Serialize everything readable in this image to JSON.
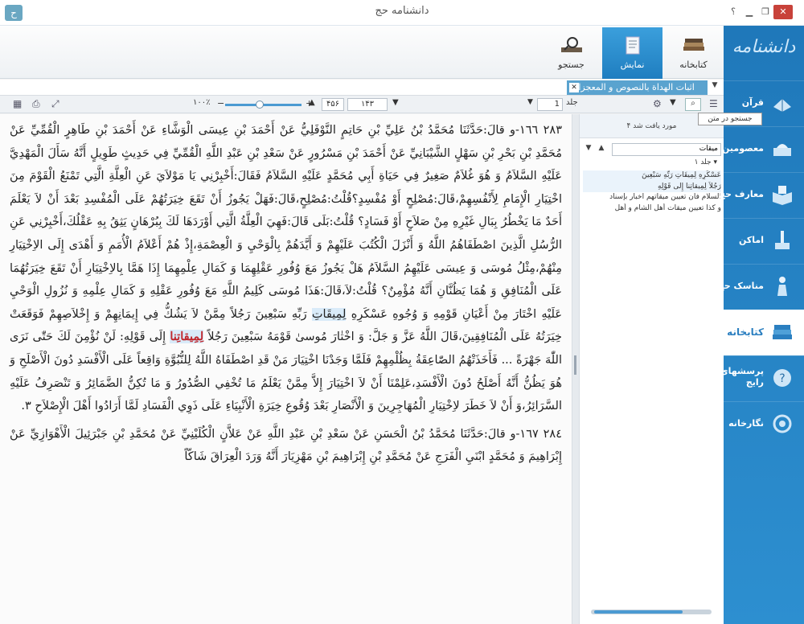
{
  "window": {
    "title": "دانشنامه حج",
    "logo_glyph": "ح",
    "help": "؟"
  },
  "nav": {
    "logo": "دانشنامه",
    "items": [
      {
        "label": "قرآن",
        "icon": "quran-icon"
      },
      {
        "label": "معصومین",
        "icon": "shrine-icon"
      },
      {
        "label": "معارف حج",
        "icon": "book-open-icon"
      },
      {
        "label": "اماکن",
        "icon": "mosque-icon"
      },
      {
        "label": "مناسک حج",
        "icon": "pilgrim-icon"
      },
      {
        "label": "کتابخانه",
        "icon": "books-icon"
      },
      {
        "label": "پرسشهای رایج",
        "icon": "question-icon"
      },
      {
        "label": "نگارخانه",
        "icon": "gallery-icon"
      }
    ],
    "active": "کتابخانه"
  },
  "ribbon": {
    "tabs": [
      {
        "label": "کتابخانه",
        "icon": "books-icon"
      },
      {
        "label": "نمایش",
        "icon": "document-icon"
      },
      {
        "label": "جستجو",
        "icon": "magnifier-book-icon"
      }
    ]
  },
  "doc_tab": {
    "title": "اثبات الهداة بالنصوص و المعجزات"
  },
  "toolbar": {
    "zoom": "۱۰۰٪",
    "page_current": "۱۴۳",
    "page_total": "۴۵۶",
    "volume_label": "جلد",
    "volume_value": "1",
    "search_tooltip": "جستجو در متن"
  },
  "search_panel": {
    "found": "۴ مورد یافت شد",
    "query": "میقات",
    "volume": "جلد ۱",
    "results": [
      "عَسْكَرِهِ لِمِيقَاتِ رَبِّهِ سَبْعِينَ",
      "رَجُلاً لِمِيقاتِنا إِلى قَوْلِهِ",
      "السلام فان تعيين ميقاتهم اخبار بإسناد",
      "و كذا تعيين ميقات أهل الشام و أهل"
    ]
  },
  "content": {
    "paragraphs": [
      "٢٨٣ ١٦٦-و قالَ:حَدَّثَنَا مُحَمَّدُ بْنُ عَلِيِّ بْنِ حَاتِمٍ النَّوْفَلِيُّ عَنْ أَحْمَدَ بْنِ عِيسَى الْوَشَّاءِ عَنْ أَحْمَدَ بْنِ طَاهِرٍ الْقُمِّيِّ عَنْ مُحَمَّدِ بْنِ بَحْرِ بْنِ سَهْلٍ الشَّيْبَانِيِّ عَنْ أَحْمَدَ بْنِ مَسْرُورٍ عَنْ سَعْدِ بْنِ عَبْدِ اللَّهِ الْقُمِّيِّ فِي حَدِيثٍ طَوِيلٍ أَنَّهُ سَأَلَ الْمَهْدِيَّ عَلَيْهِ السَّلاَمُ وَ هُوَ غُلاَمٌ صَغِيرٌ فِي حَيَاةِ أَبِي مُحَمَّدٍ عَلَيْهِ السَّلاَمُ فَقَالَ:أَخْبِرْنِي يَا مَوْلاَيَ عَنِ الْعِلَّةِ الَّتِي تَمْنَعُ الْقَوْمَ مِنَ اخْتِيَارِ الْإِمَامِ لِأَنْفُسِهِمْ،قَالَ:مُصْلِحٍ أَوْ مُفْسِدٍ؟قُلْتُ:مُصْلِحٍ،قَالَ:فَهَلْ يَجُوزُ أَنْ تَقَعَ خِيَرَتُهُمْ عَلَى الْمُفْسِدِ بَعْدَ أَنْ لاَ يَعْلَمَ أَحَدٌ مَا يَخْطُرُ بِبَالِ غَيْرِهِ مِنْ صَلاَحٍ أَوْ فَسَادٍ؟ قُلْتُ:بَلَى قَالَ:فَهِيَ الْعِلَّةُ الَّتِي أَوْرَدَهَا لَكَ بِبُرْهَانٍ يَثِقُ بِهِ عَقْلُكَ،أَخْبِرْنِي عَنِ الرُّسُلِ الَّذِينَ اصْطَفَاهُمُ اللَّهُ وَ أَنْزَلَ الْكُتُبَ عَلَيْهِمْ وَ أَيَّدَهُمْ بِالْوَحْيِ وَ الْعِصْمَةِ،إِذْ هُمْ أَعْلاَمُ الْأُمَمِ وَ أَهْدَى إِلَى الاِخْتِيَارِ مِنْهُمْ،مِثْلُ مُوسَى وَ عِيسَى عَلَيْهِمُ السَّلاَمُ هَلْ يَجُوزُ مَعَ وُفُورِ عَقْلِهِمَا وَ كَمَالِ عِلْمِهِمَا إِذَا هَمَّا بِالاِخْتِيَارِ أَنْ تَقَعَ خِيَرَتُهُمَا عَلَى الْمُنَافِقِ وَ هُمَا يَظُنَّانِ أَنَّهُ مُؤْمِنٌ؟ قُلْتُ:لاَ،قَالَ:هَذَا مُوسَى كَلِيمُ اللَّهِ مَعَ وُفُورِ عَقْلِهِ وَ كَمَالِ عِلْمِهِ وَ نُزُولِ الْوَحْيِ عَلَيْهِ اخْتَارَ مِنْ أَعْيَانِ قَوْمِهِ وَ وُجُوهِ عَسْكَرِهِ ",
      "رَبِّهِ سَبْعِينَ رَجُلاً مِمَّنْ لاَ يَشُكُّ فِي إِيمَانِهِمْ وَ إِخْلاَصِهِمْ فَوَقَعَتْ خِيَرَتُهُ عَلَى الْمُنَافِقِينَ،قَالَ اللَّهُ عَزَّ وَ جَلَّ: وَ اخْتٰارَ مُوسىٰ قَوْمَهُ سَبْعِينَ رَجُلاً ",
      " إِلَى قَوْلِهِ: لَنْ نُؤْمِنَ لَكَ حَتّٰى نَرَى اللّٰهَ جَهْرَةً ... فَأَخَذَتْهُمُ الصّٰاعِقَةُ بِظُلْمِهِمْ فَلَمَّا وَجَدْنَا اخْتِيَارَ مَنْ قَدِ اصْطَفَاهُ اللَّهُ لِلنُّبُوَّةِ وَاقِعاً عَلَى الْأَفْسَدِ دُونَ الْأَصْلَحِ وَ هُوَ يَظُنُّ أَنَّهُ أَصْلَحُ دُونَ الْأَفْسَدِ،عَلِمْنَا أَنْ لاَ اخْتِيَارَ إِلاَّ مِمَّنْ يَعْلَمُ مَا تُخْفِي الصُّدُورُ وَ مَا تُكِنُّ الضَّمَائِرُ وَ تَنْصَرِفُ عَلَيْهِ السَّرَائِرُ،وَ أَنْ لاَ خَطَرَ لاِخْتِيَارِ الْمُهَاجِرِينَ وَ الْأَنْصَارِ بَعْدَ وُقُوعِ خِيَرَةِ الْأَنْبِيَاءِ عَلَى ذَوِي الْفَسَادِ لَمَّا أَرَادُوا أَهْلَ الْإِصْلاَحِ ٣.",
      "٢٨٤ ١٦٧-و قالَ:حَدَّثَنَا مُحَمَّدُ بْنُ الْحَسَنِ عَنْ سَعْدِ بْنِ عَبْدِ اللَّهِ عَنْ عَلاَّنٍ الْكُلَيْنِيِّ عَنْ مُحَمَّدِ بْنِ جَبْرَئِيلَ الْأَهْوَازِيِّ عَنْ إِبْرَاهِيمَ وَ مُحَمَّدٍ ابْنَيِ الْفَرَجِ عَنْ مُحَمَّدِ بْنِ إِبْرَاهِيمَ بْنِ مَهْزِيَارَ أَنَّهُ وَرَدَ الْعِرَاقَ شَاكّاً"
    ],
    "hl_1": "لِمِيقَاتِ",
    "hl_2": "لِمِيقاتِنا"
  }
}
